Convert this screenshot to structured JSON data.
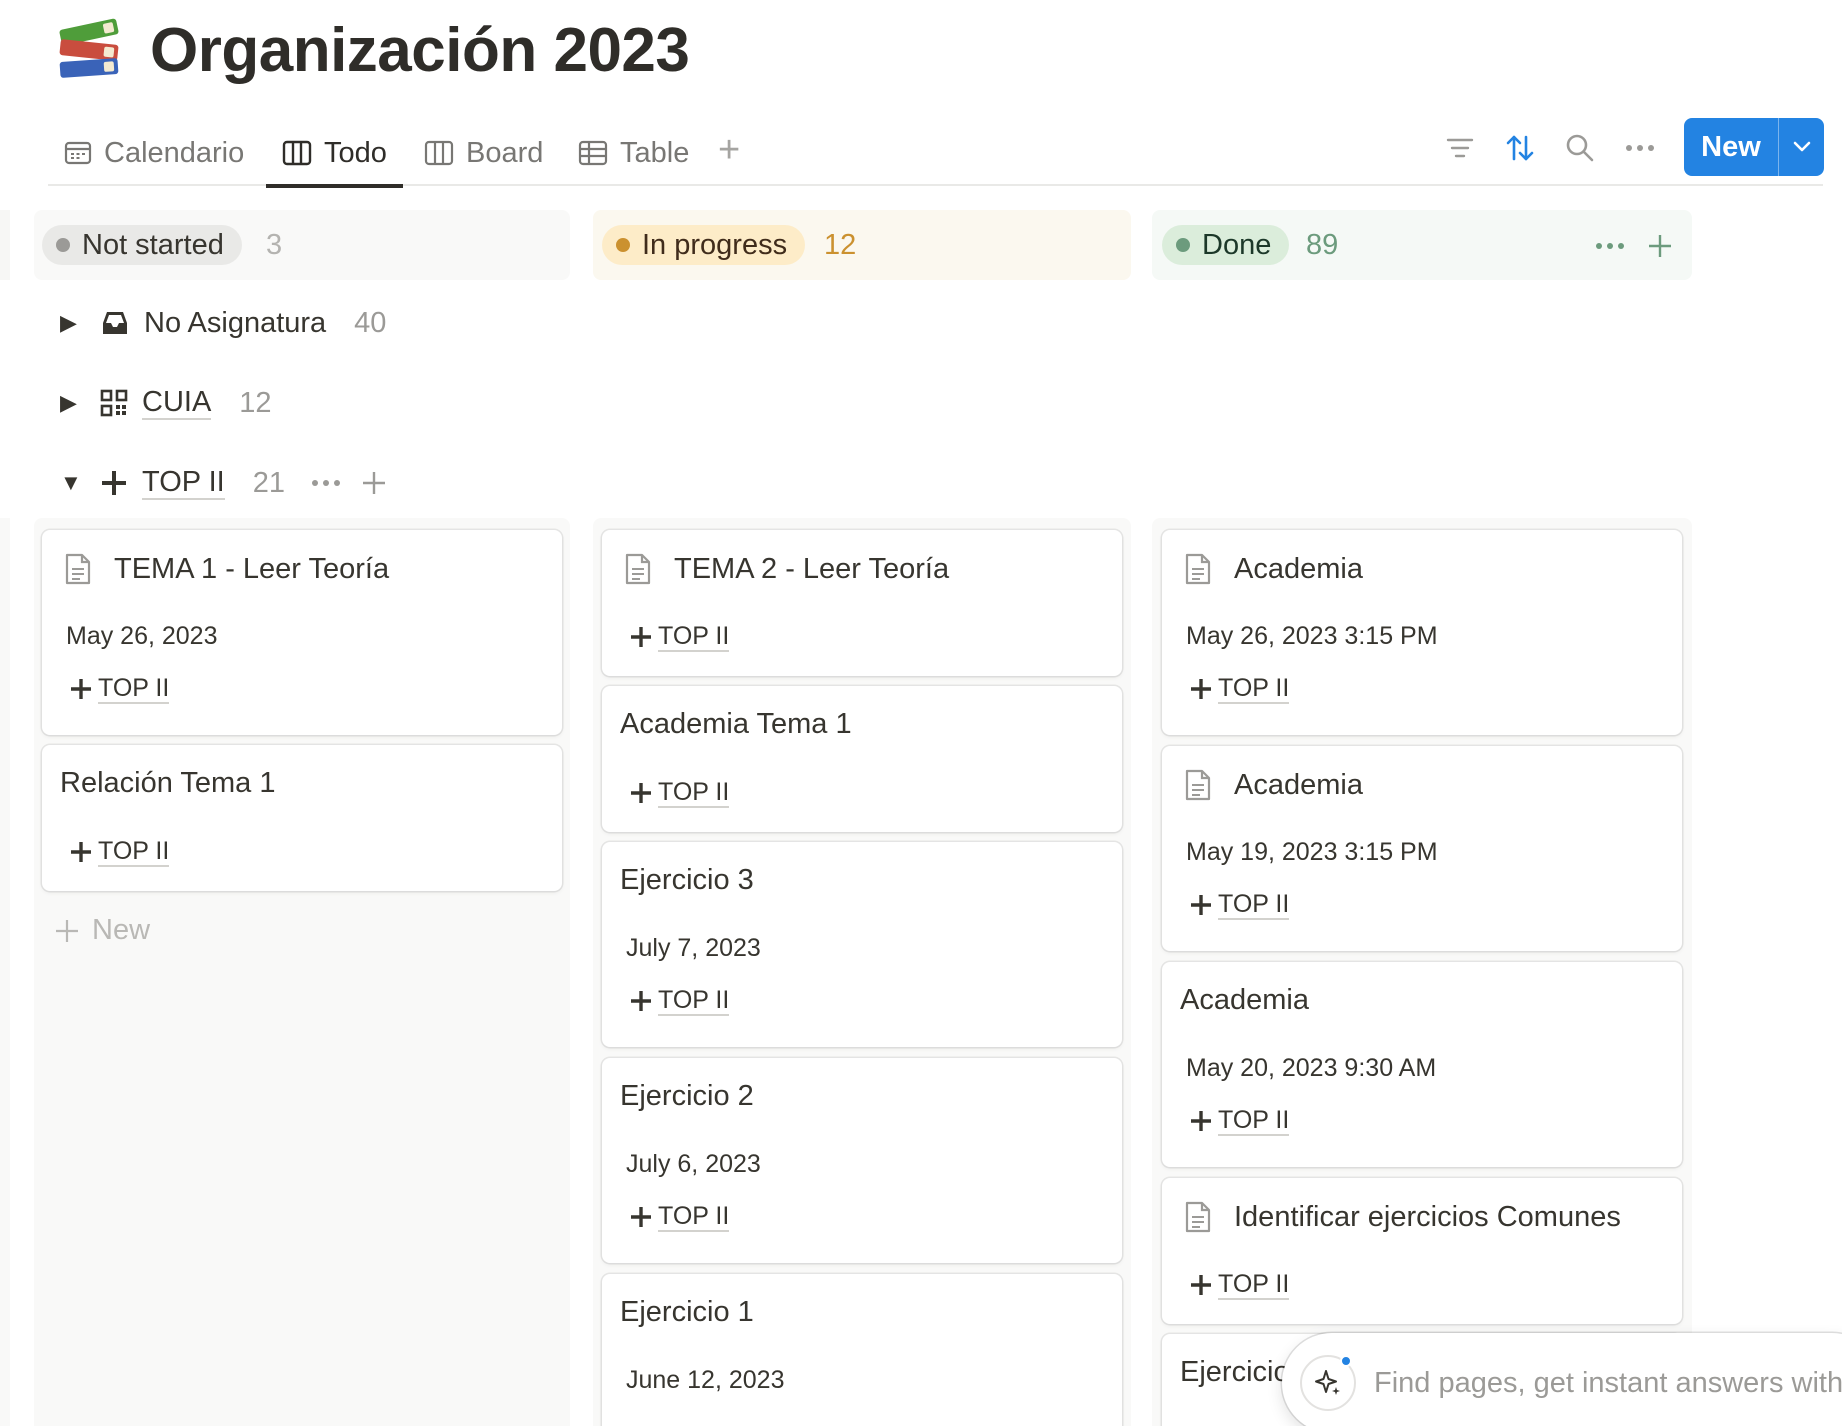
{
  "page": {
    "title": "Organización 2023",
    "icon": "books-emoji"
  },
  "views": [
    {
      "label": "Calendario",
      "icon": "calendar-icon",
      "active": false
    },
    {
      "label": "Todo",
      "icon": "board-icon",
      "active": true
    },
    {
      "label": "Board",
      "icon": "board-icon",
      "active": false
    },
    {
      "label": "Table",
      "icon": "table-icon",
      "active": false
    }
  ],
  "toolbar": {
    "new_label": "New"
  },
  "columns": [
    {
      "status": "Not started",
      "count": "3",
      "dot_color": "#9b9a97",
      "pill_bg": "#e9e9e7",
      "bg": "#f9f9f8",
      "count_color": "#b4b3b0"
    },
    {
      "status": "In progress",
      "count": "12",
      "dot_color": "#cb912f",
      "pill_bg": "#fdecc8",
      "bg": "#fbf8ef",
      "count_color": "#cb912f"
    },
    {
      "status": "Done",
      "count": "89",
      "dot_color": "#6c9b7d",
      "pill_bg": "#dbeddb",
      "bg": "#f5f9f6",
      "count_color": "#6c9b7d"
    }
  ],
  "groups": [
    {
      "name": "No Asignatura",
      "count": "40",
      "expanded": false,
      "icon": "inbox-icon"
    },
    {
      "name": "CUIA",
      "count": "12",
      "expanded": false,
      "icon": "qr-code-icon"
    },
    {
      "name": "TOP II",
      "count": "21",
      "expanded": true,
      "icon": "plus-icon"
    }
  ],
  "cards": {
    "not_started": [
      {
        "title": "TEMA 1 - Leer Teoría",
        "date": "May 26, 2023",
        "tag": "TOP II",
        "doc_icon": true
      },
      {
        "title": "Relación Tema 1",
        "date": "",
        "tag": "TOP II",
        "doc_icon": false
      }
    ],
    "in_progress": [
      {
        "title": "TEMA 2 - Leer Teoría",
        "date": "",
        "tag": "TOP II",
        "doc_icon": true
      },
      {
        "title": "Academia Tema 1",
        "date": "",
        "tag": "TOP II",
        "doc_icon": false
      },
      {
        "title": "Ejercicio 3",
        "date": "July 7, 2023",
        "tag": "TOP II",
        "doc_icon": false
      },
      {
        "title": "Ejercicio 2",
        "date": "July 6, 2023",
        "tag": "TOP II",
        "doc_icon": false
      },
      {
        "title": "Ejercicio 1",
        "date": "June 12, 2023",
        "tag": "",
        "doc_icon": false
      }
    ],
    "done": [
      {
        "title": "Academia",
        "date": "May 26, 2023 3:15 PM",
        "tag": "TOP II",
        "doc_icon": true
      },
      {
        "title": "Academia",
        "date": "May 19, 2023 3:15 PM",
        "tag": "TOP II",
        "doc_icon": true
      },
      {
        "title": "Academia",
        "date": "May 20, 2023 9:30 AM",
        "tag": "TOP II",
        "doc_icon": false
      },
      {
        "title": "Identificar ejercicios Comunes",
        "date": "",
        "tag": "TOP II",
        "doc_icon": true
      },
      {
        "title": "Ejercicio",
        "date": "",
        "tag": "",
        "doc_icon": false
      }
    ]
  },
  "new_item_label": "New",
  "ai_search": {
    "placeholder": "Find pages, get instant answers with"
  }
}
